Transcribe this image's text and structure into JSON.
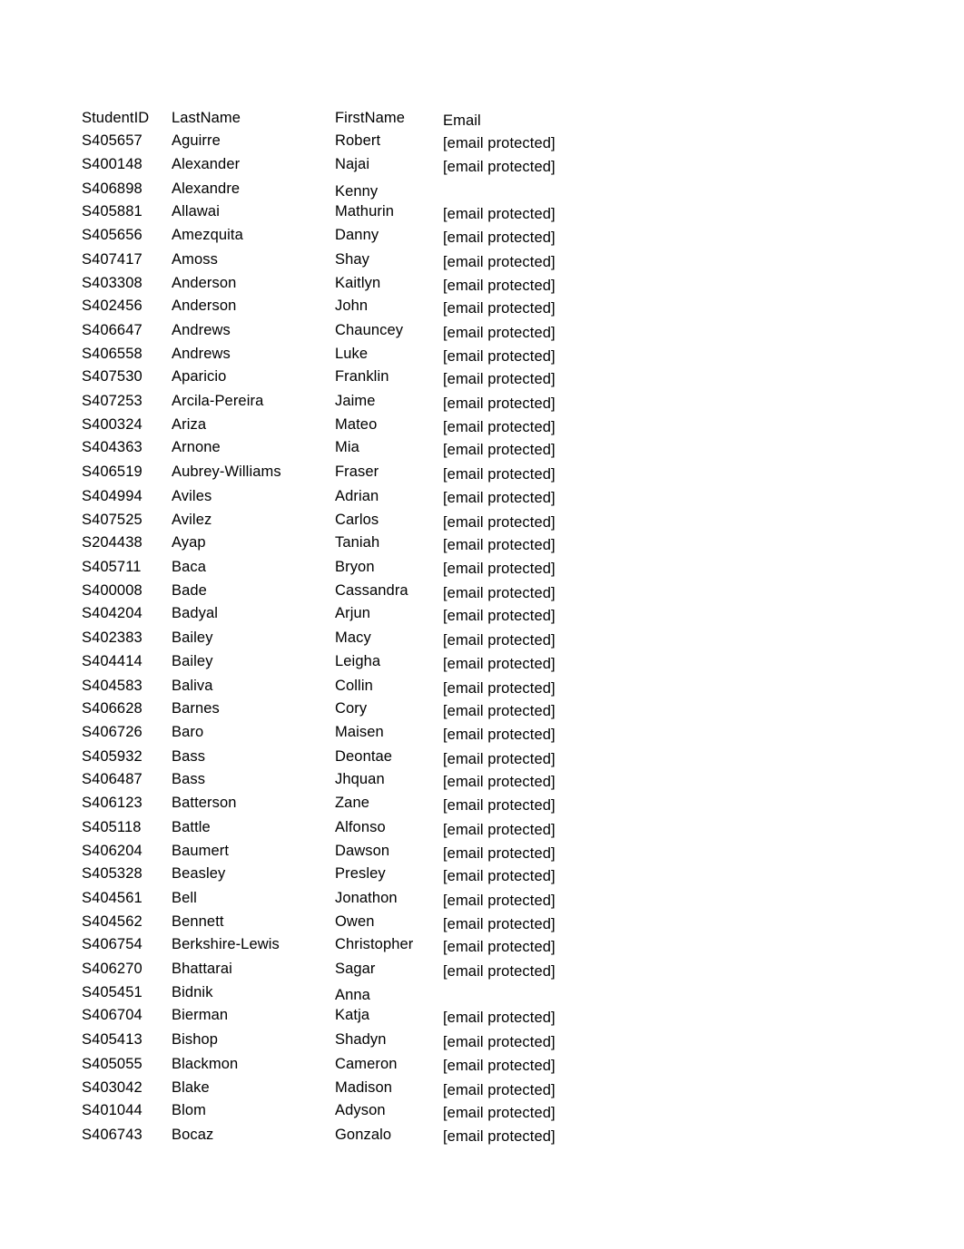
{
  "table": {
    "headers": {
      "student_id": "StudentID",
      "last_name": "LastName",
      "first_name": "FirstName",
      "email": "Email"
    },
    "rows": [
      {
        "student_id": "S405657",
        "last_name": "Aguirre",
        "first_name": "Robert",
        "email": "[email protected]"
      },
      {
        "student_id": "S400148",
        "last_name": "Alexander",
        "first_name": "Najai",
        "email": "[email protected]"
      },
      {
        "student_id": "S406898",
        "last_name": "Alexandre",
        "first_name": "Kenny",
        "email": ""
      },
      {
        "student_id": "S405881",
        "last_name": "Allawai",
        "first_name": "Mathurin",
        "email": "[email protected]"
      },
      {
        "student_id": "S405656",
        "last_name": "Amezquita",
        "first_name": "Danny",
        "email": "[email protected]"
      },
      {
        "student_id": "S407417",
        "last_name": "Amoss",
        "first_name": "Shay",
        "email": "[email protected]"
      },
      {
        "student_id": "S403308",
        "last_name": "Anderson",
        "first_name": "Kaitlyn",
        "email": "[email protected]"
      },
      {
        "student_id": "S402456",
        "last_name": "Anderson",
        "first_name": "John",
        "email": "[email protected]"
      },
      {
        "student_id": "S406647",
        "last_name": "Andrews",
        "first_name": "Chauncey",
        "email": "[email protected]"
      },
      {
        "student_id": "S406558",
        "last_name": "Andrews",
        "first_name": "Luke",
        "email": "[email protected]"
      },
      {
        "student_id": "S407530",
        "last_name": "Aparicio",
        "first_name": "Franklin",
        "email": "[email protected]"
      },
      {
        "student_id": "S407253",
        "last_name": "Arcila-Pereira",
        "first_name": "Jaime",
        "email": "[email protected]"
      },
      {
        "student_id": "S400324",
        "last_name": "Ariza",
        "first_name": "Mateo",
        "email": "[email protected]"
      },
      {
        "student_id": "S404363",
        "last_name": "Arnone",
        "first_name": "Mia",
        "email": "[email protected]"
      },
      {
        "student_id": "S406519",
        "last_name": "Aubrey-Williams",
        "first_name": "Fraser",
        "email": "[email protected]"
      },
      {
        "student_id": "S404994",
        "last_name": "Aviles",
        "first_name": "Adrian",
        "email": "[email protected]"
      },
      {
        "student_id": "S407525",
        "last_name": "Avilez",
        "first_name": "Carlos",
        "email": "[email protected]"
      },
      {
        "student_id": "S204438",
        "last_name": "Ayap",
        "first_name": "Taniah",
        "email": "[email protected]"
      },
      {
        "student_id": "S405711",
        "last_name": "Baca",
        "first_name": "Bryon",
        "email": "[email protected]"
      },
      {
        "student_id": "S400008",
        "last_name": "Bade",
        "first_name": "Cassandra",
        "email": "[email protected]"
      },
      {
        "student_id": "S404204",
        "last_name": "Badyal",
        "first_name": "Arjun",
        "email": "[email protected]"
      },
      {
        "student_id": "S402383",
        "last_name": "Bailey",
        "first_name": "Macy",
        "email": "[email protected]"
      },
      {
        "student_id": "S404414",
        "last_name": "Bailey",
        "first_name": "Leigha",
        "email": "[email protected]"
      },
      {
        "student_id": "S404583",
        "last_name": "Baliva",
        "first_name": "Collin",
        "email": "[email protected]"
      },
      {
        "student_id": "S406628",
        "last_name": "Barnes",
        "first_name": "Cory",
        "email": "[email protected]"
      },
      {
        "student_id": "S406726",
        "last_name": "Baro",
        "first_name": "Maisen",
        "email": "[email protected]"
      },
      {
        "student_id": "S405932",
        "last_name": "Bass",
        "first_name": "Deontae",
        "email": "[email protected]"
      },
      {
        "student_id": "S406487",
        "last_name": "Bass",
        "first_name": "Jhquan",
        "email": "[email protected]"
      },
      {
        "student_id": "S406123",
        "last_name": "Batterson",
        "first_name": "Zane",
        "email": "[email protected]"
      },
      {
        "student_id": "S405118",
        "last_name": "Battle",
        "first_name": "Alfonso",
        "email": "[email protected]"
      },
      {
        "student_id": "S406204",
        "last_name": "Baumert",
        "first_name": "Dawson",
        "email": "[email protected]"
      },
      {
        "student_id": "S405328",
        "last_name": "Beasley",
        "first_name": "Presley",
        "email": "[email protected]"
      },
      {
        "student_id": "S404561",
        "last_name": "Bell",
        "first_name": "Jonathon",
        "email": "[email protected]"
      },
      {
        "student_id": "S404562",
        "last_name": "Bennett",
        "first_name": "Owen",
        "email": "[email protected]"
      },
      {
        "student_id": "S406754",
        "last_name": "Berkshire-Lewis",
        "first_name": "Christopher",
        "email": "[email protected]"
      },
      {
        "student_id": "S406270",
        "last_name": "Bhattarai",
        "first_name": "Sagar",
        "email": "[email protected]"
      },
      {
        "student_id": "S405451",
        "last_name": "Bidnik",
        "first_name": "Anna",
        "email": ""
      },
      {
        "student_id": "S406704",
        "last_name": "Bierman",
        "first_name": "Katja",
        "email": "[email protected]"
      },
      {
        "student_id": "S405413",
        "last_name": "Bishop",
        "first_name": "Shadyn",
        "email": "[email protected]"
      },
      {
        "student_id": "S405055",
        "last_name": "Blackmon",
        "first_name": "Cameron",
        "email": "[email protected]"
      },
      {
        "student_id": "S403042",
        "last_name": "Blake",
        "first_name": "Madison",
        "email": "[email protected]"
      },
      {
        "student_id": "S401044",
        "last_name": "Blom",
        "first_name": "Adyson",
        "email": "[email protected]"
      },
      {
        "student_id": "S406743",
        "last_name": "Bocaz",
        "first_name": "Gonzalo",
        "email": "[email protected]"
      }
    ]
  }
}
